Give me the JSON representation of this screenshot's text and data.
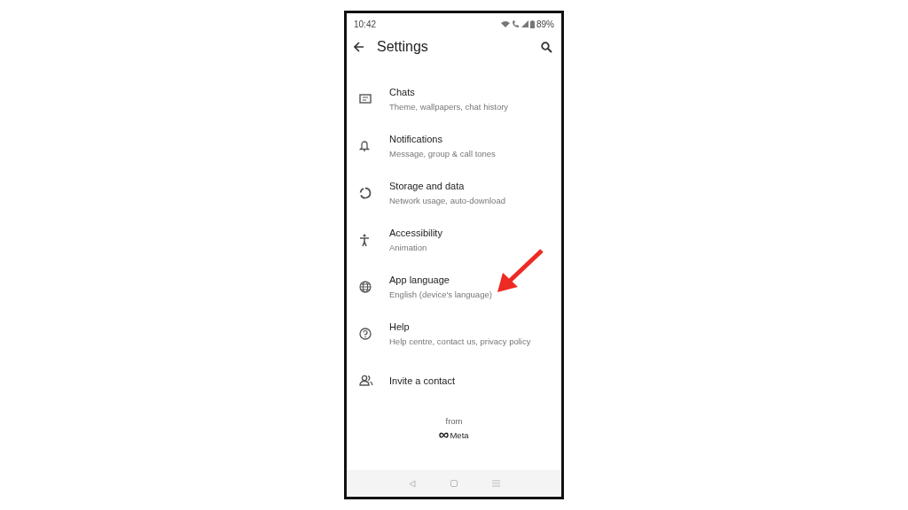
{
  "status_bar": {
    "time": "10:42",
    "battery": "89%"
  },
  "header": {
    "title": "Settings"
  },
  "items": [
    {
      "title": "Chats",
      "subtitle": "Theme, wallpapers, chat history"
    },
    {
      "title": "Notifications",
      "subtitle": "Message, group & call tones"
    },
    {
      "title": "Storage and data",
      "subtitle": "Network usage, auto-download"
    },
    {
      "title": "Accessibility",
      "subtitle": "Animation"
    },
    {
      "title": "App language",
      "subtitle": "English (device's language)"
    },
    {
      "title": "Help",
      "subtitle": "Help centre, contact us, privacy policy"
    },
    {
      "title": "Invite a contact"
    }
  ],
  "footer": {
    "from": "from",
    "brand": "Meta"
  }
}
